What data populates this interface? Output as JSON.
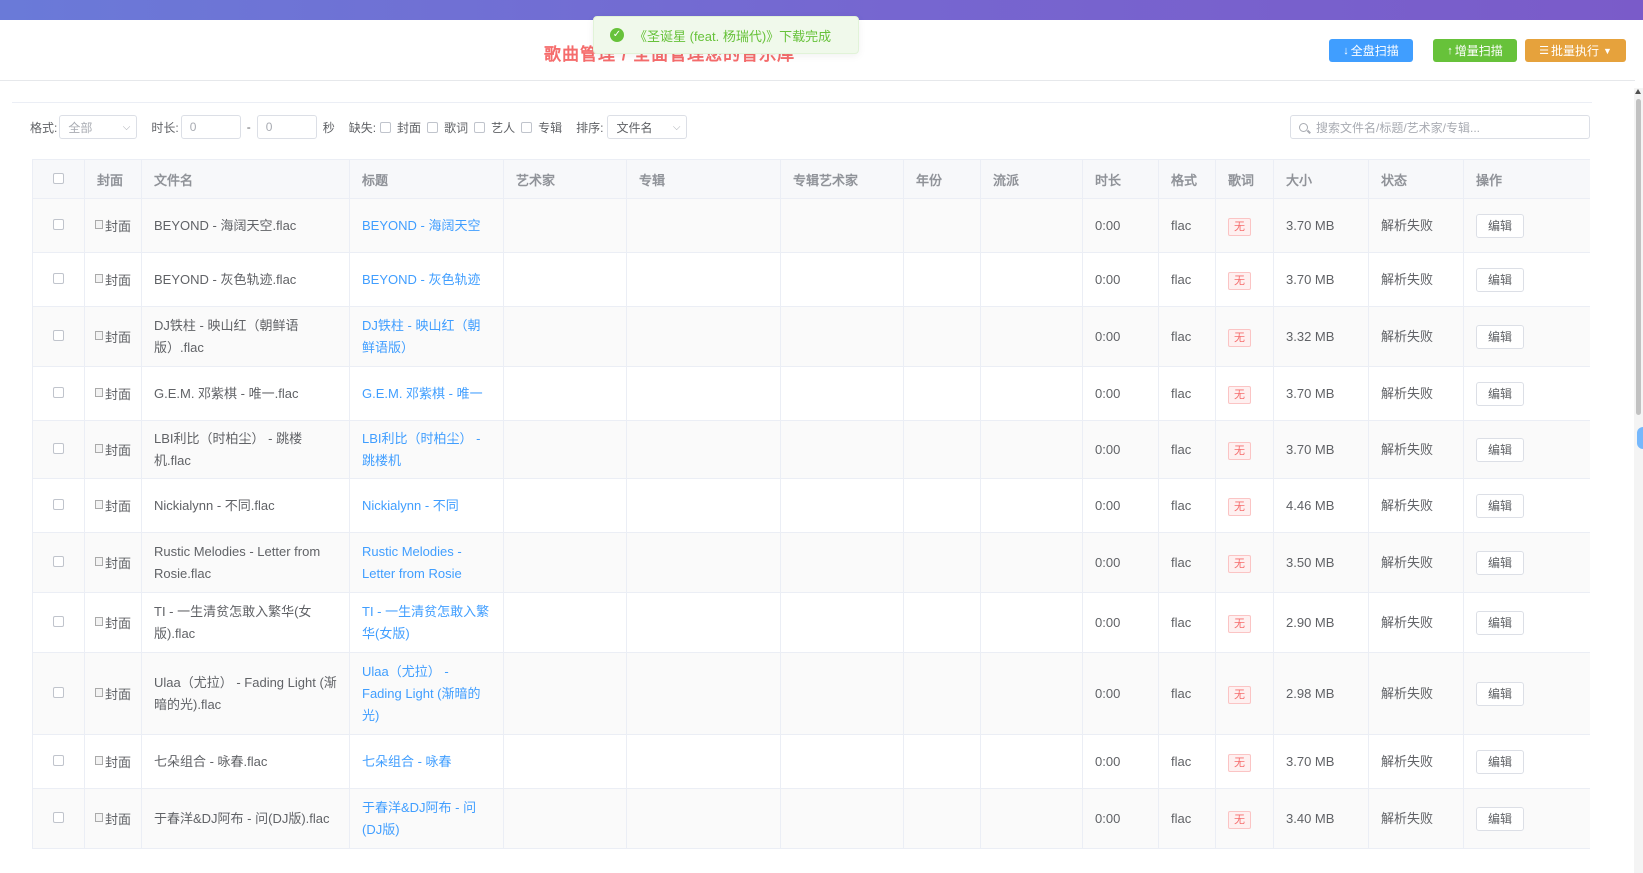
{
  "header": {
    "title": "歌曲管理 / 全面管理您的音乐库",
    "buttons": {
      "full_scan": "全盘扫描",
      "incremental_scan": "增量扫描",
      "batch_execute": "批量执行"
    }
  },
  "toast": {
    "message": "《圣诞星 (feat. 杨瑞代)》下载完成",
    "type": "success"
  },
  "filters": {
    "format_label": "格式:",
    "format_value": "全部",
    "duration_label": "时长:",
    "duration_min_placeholder": "0",
    "duration_separator": "-",
    "duration_max_placeholder": "0",
    "duration_unit": "秒",
    "missing_label": "缺失:",
    "missing_options": [
      "封面",
      "歌词",
      "艺人",
      "专辑"
    ],
    "sort_label": "排序:",
    "sort_value": "文件名",
    "search_placeholder": "搜索文件名/标题/艺术家/专辑..."
  },
  "table": {
    "columns": [
      "",
      "封面",
      "文件名",
      "标题",
      "艺术家",
      "专辑",
      "专辑艺术家",
      "年份",
      "流派",
      "时长",
      "格式",
      "歌词",
      "大小",
      "状态",
      "操作"
    ],
    "cover_alt": "封面",
    "edit_label": "编辑",
    "rows": [
      {
        "filename": "BEYOND - 海阔天空.flac",
        "title": "BEYOND - 海阔天空",
        "artist": "",
        "album": "",
        "album_artist": "",
        "year": "",
        "genre": "",
        "duration": "0:00",
        "format": "flac",
        "lyrics": "无",
        "size": "3.70 MB",
        "status": "解析失败"
      },
      {
        "filename": "BEYOND - 灰色轨迹.flac",
        "title": "BEYOND - 灰色轨迹",
        "artist": "",
        "album": "",
        "album_artist": "",
        "year": "",
        "genre": "",
        "duration": "0:00",
        "format": "flac",
        "lyrics": "无",
        "size": "3.70 MB",
        "status": "解析失败"
      },
      {
        "filename": "DJ铁柱 - 映山红（朝鲜语版）.flac",
        "title": "DJ铁柱 - 映山红（朝鲜语版）",
        "artist": "",
        "album": "",
        "album_artist": "",
        "year": "",
        "genre": "",
        "duration": "0:00",
        "format": "flac",
        "lyrics": "无",
        "size": "3.32 MB",
        "status": "解析失败"
      },
      {
        "filename": "G.E.M. 邓紫棋 - 唯一.flac",
        "title": "G.E.M. 邓紫棋 - 唯一",
        "artist": "",
        "album": "",
        "album_artist": "",
        "year": "",
        "genre": "",
        "duration": "0:00",
        "format": "flac",
        "lyrics": "无",
        "size": "3.70 MB",
        "status": "解析失败"
      },
      {
        "filename": "LBI利比（时柏尘） - 跳楼机.flac",
        "title": "LBI利比（时柏尘） - 跳楼机",
        "artist": "",
        "album": "",
        "album_artist": "",
        "year": "",
        "genre": "",
        "duration": "0:00",
        "format": "flac",
        "lyrics": "无",
        "size": "3.70 MB",
        "status": "解析失败"
      },
      {
        "filename": "Nickialynn - 不同.flac",
        "title": "Nickialynn - 不同",
        "artist": "",
        "album": "",
        "album_artist": "",
        "year": "",
        "genre": "",
        "duration": "0:00",
        "format": "flac",
        "lyrics": "无",
        "size": "4.46 MB",
        "status": "解析失败"
      },
      {
        "filename": "Rustic Melodies - Letter from Rosie.flac",
        "title": "Rustic Melodies - Letter from Rosie",
        "artist": "",
        "album": "",
        "album_artist": "",
        "year": "",
        "genre": "",
        "duration": "0:00",
        "format": "flac",
        "lyrics": "无",
        "size": "3.50 MB",
        "status": "解析失败"
      },
      {
        "filename": "TI - 一生清贫怎敢入繁华(女版).flac",
        "title": "TI - 一生清贫怎敢入繁华(女版)",
        "artist": "",
        "album": "",
        "album_artist": "",
        "year": "",
        "genre": "",
        "duration": "0:00",
        "format": "flac",
        "lyrics": "无",
        "size": "2.90 MB",
        "status": "解析失败"
      },
      {
        "filename": "Ulaa（尤拉） - Fading Light (渐暗的光).flac",
        "title": "Ulaa（尤拉） - Fading Light (渐暗的光)",
        "artist": "",
        "album": "",
        "album_artist": "",
        "year": "",
        "genre": "",
        "duration": "0:00",
        "format": "flac",
        "lyrics": "无",
        "size": "2.98 MB",
        "status": "解析失败"
      },
      {
        "filename": "七朵组合 - 咏春.flac",
        "title": "七朵组合 - 咏春",
        "artist": "",
        "album": "",
        "album_artist": "",
        "year": "",
        "genre": "",
        "duration": "0:00",
        "format": "flac",
        "lyrics": "无",
        "size": "3.70 MB",
        "status": "解析失败"
      },
      {
        "filename": "于春洋&DJ阿布 - 问(DJ版).flac",
        "title": "于春洋&DJ阿布 - 问(DJ版)",
        "artist": "",
        "album": "",
        "album_artist": "",
        "year": "",
        "genre": "",
        "duration": "0:00",
        "format": "flac",
        "lyrics": "无",
        "size": "3.40 MB",
        "status": "解析失败"
      }
    ]
  },
  "colors": {
    "primary": "#409eff",
    "success": "#67c23a",
    "warning": "#e6a23c",
    "danger": "#f56c6c",
    "title_red": "#f56c6c",
    "top_gradient_start": "#6a7ad8",
    "top_gradient_end": "#7a5bc9"
  },
  "icons": {
    "toast": "check-circle-icon",
    "full_scan": "download-icon",
    "incremental_scan": "upload-icon",
    "batch_execute": "list-icon",
    "batch_dropdown": "chevron-down-icon",
    "search": "search-icon",
    "select_arrow": "chevron-down-icon"
  }
}
